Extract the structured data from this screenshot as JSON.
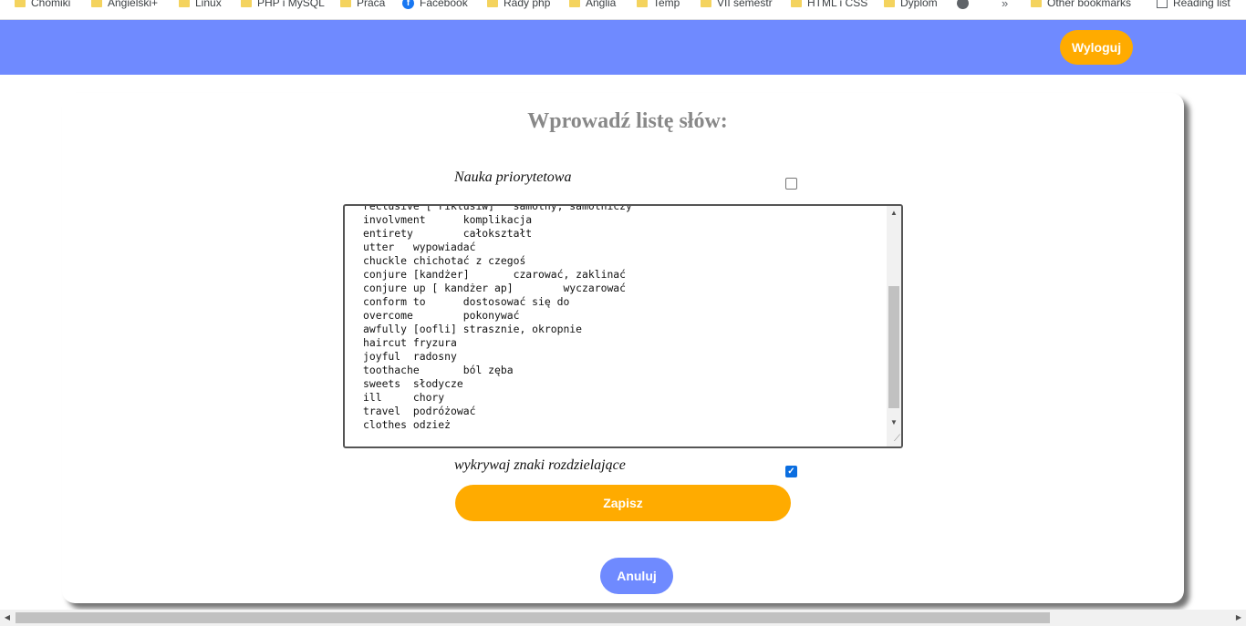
{
  "bookmarks": [
    {
      "label": "Chomiki",
      "icon": "folder-icon"
    },
    {
      "label": "Angielski+",
      "icon": "folder-icon"
    },
    {
      "label": "Linux",
      "icon": "folder-icon"
    },
    {
      "label": "PHP i MySQL",
      "icon": "folder-icon"
    },
    {
      "label": "Praca",
      "icon": "folder-icon"
    },
    {
      "label": "Facebook",
      "icon": "facebook-icon"
    },
    {
      "label": "Rady php",
      "icon": "folder-icon"
    },
    {
      "label": "Anglia",
      "icon": "folder-icon"
    },
    {
      "label": "Temp",
      "icon": "folder-icon"
    },
    {
      "label": "VII semestr",
      "icon": "folder-icon"
    },
    {
      "label": "HTML i CSS",
      "icon": "folder-icon"
    },
    {
      "label": "Dyplom",
      "icon": "folder-icon"
    }
  ],
  "bookmarks_overflow": "»",
  "other_bookmarks": "Other bookmarks",
  "reading_list": "Reading list",
  "header": {
    "logout_label": "Wyloguj",
    "color": "#6f8aff",
    "button_color": "#ffab00"
  },
  "form": {
    "title": "Wprowadź listę słów:",
    "priority_label": "Nauka priorytetowa",
    "priority_checked": false,
    "word_lines": [
      "reclusive [ riklusiw]   samotny, samotniczy",
      "involvment      komplikacja",
      "entirety        całokształt",
      "utter   wypowiadać",
      "chuckle chichotać z czegoś",
      "conjure [kandżer]       czarować, zaklinać",
      "conjure up [ kandżer ap]        wyczarować",
      "conform to      dostosować się do",
      "overcome        pokonywać",
      "awfully [oofli] strasznie, okropnie",
      "haircut fryzura",
      "joyful  radosny",
      "toothache       ból zęba",
      "sweets  słodycze",
      "ill     chory",
      "travel  podróżować",
      "clothes odzież"
    ],
    "separators_label": "wykrywaj znaki rozdzielające",
    "separators_checked": true,
    "save_label": "Zapisz",
    "cancel_label": "Anuluj"
  }
}
